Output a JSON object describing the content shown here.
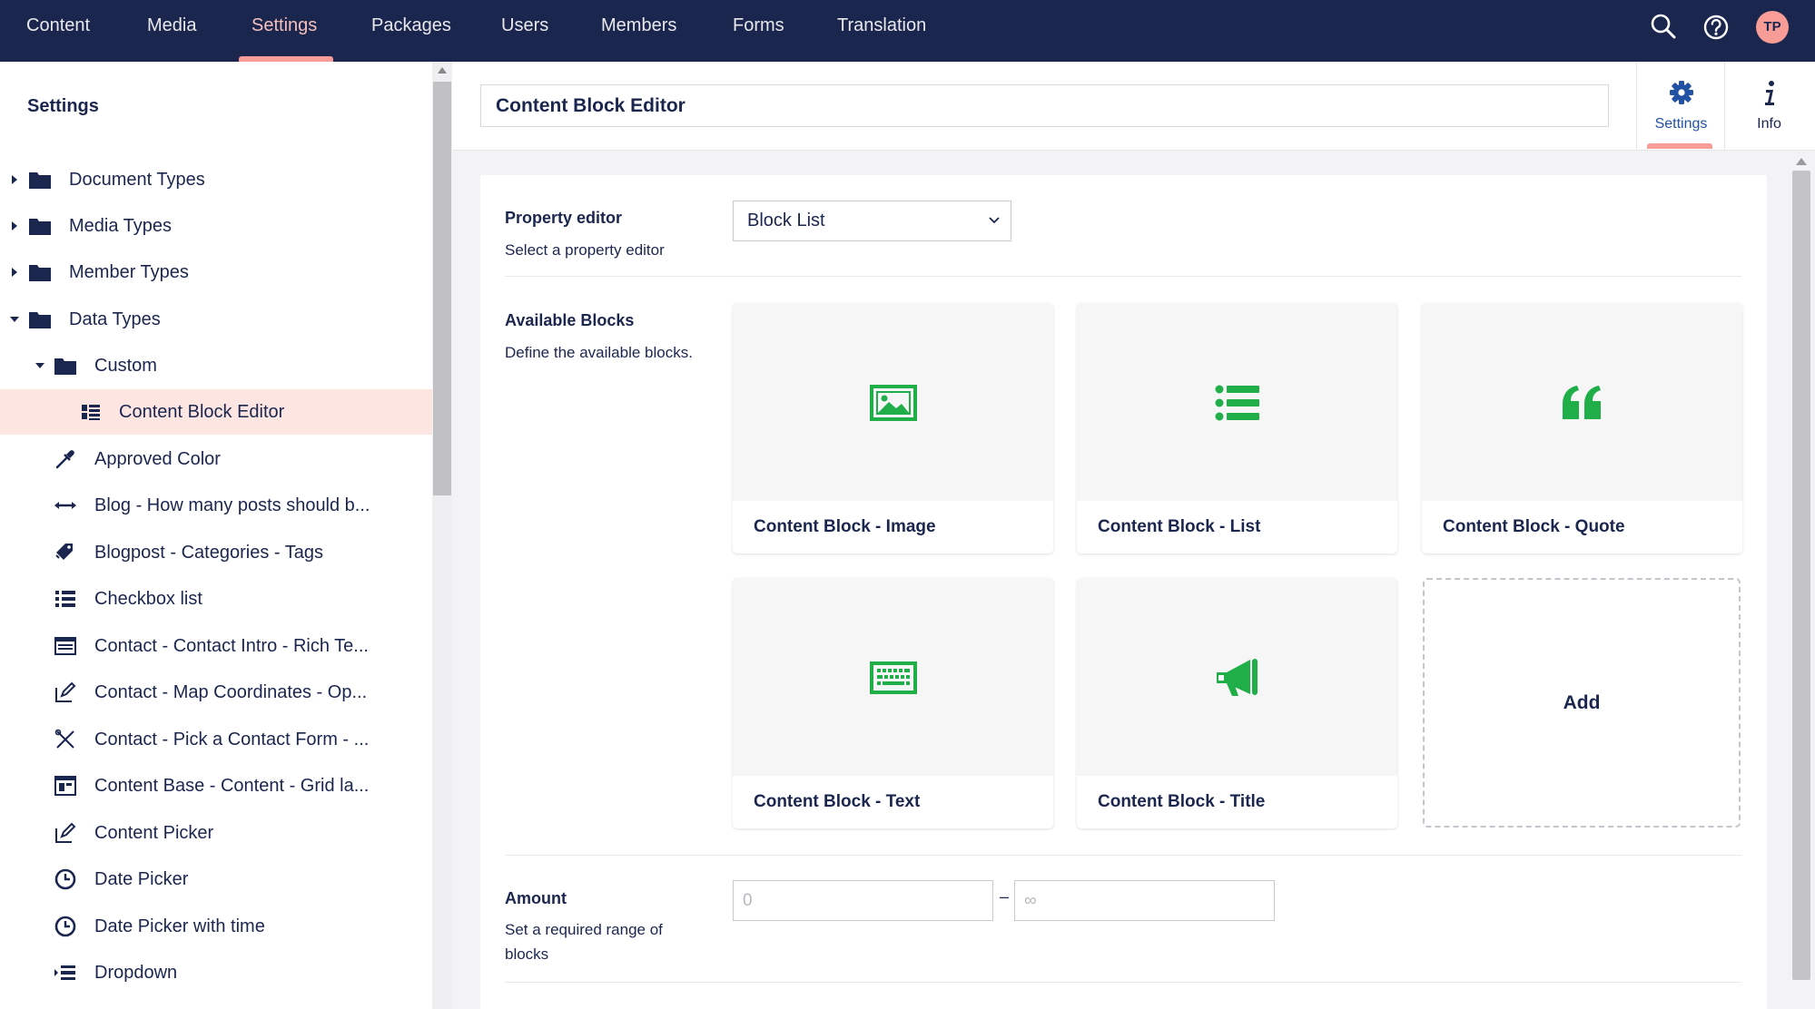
{
  "colors": {
    "nav_bg": "#1b264f",
    "accent": "#f79c96",
    "block_icon": "#1fae48",
    "selected_bg": "#fde5e1"
  },
  "nav": {
    "items": [
      {
        "label": "Content"
      },
      {
        "label": "Media"
      },
      {
        "label": "Settings",
        "active": true
      },
      {
        "label": "Packages"
      },
      {
        "label": "Users"
      },
      {
        "label": "Members"
      },
      {
        "label": "Forms"
      },
      {
        "label": "Translation"
      }
    ],
    "search_icon": "search-icon",
    "help_icon": "help-icon",
    "avatar_initials": "TP"
  },
  "sidebar": {
    "title": "Settings",
    "tree": [
      {
        "label": "Document Types",
        "icon": "folder-icon",
        "caret": "collapsed"
      },
      {
        "label": "Media Types",
        "icon": "folder-icon",
        "caret": "collapsed"
      },
      {
        "label": "Member Types",
        "icon": "folder-icon",
        "caret": "collapsed"
      },
      {
        "label": "Data Types",
        "icon": "folder-icon",
        "caret": "expanded"
      },
      {
        "label": "Custom",
        "icon": "folder-icon",
        "caret": "expanded"
      },
      {
        "label": "Content Block Editor",
        "icon": "block-list-icon",
        "selected": true
      },
      {
        "label": "Approved Color",
        "icon": "eyedropper-icon"
      },
      {
        "label": "Blog - How many posts should b...",
        "icon": "range-arrows-icon"
      },
      {
        "label": "Blogpost - Categories - Tags",
        "icon": "tags-icon"
      },
      {
        "label": "Checkbox list",
        "icon": "checklist-icon"
      },
      {
        "label": "Contact - Contact Intro - Rich Te...",
        "icon": "rich-text-icon"
      },
      {
        "label": "Contact - Map Coordinates - Op...",
        "icon": "edit-icon"
      },
      {
        "label": "Contact - Pick a Contact Form - ...",
        "icon": "crossed-tools-icon"
      },
      {
        "label": "Content Base - Content - Grid la...",
        "icon": "grid-layout-icon"
      },
      {
        "label": "Content Picker",
        "icon": "edit-icon"
      },
      {
        "label": "Date Picker",
        "icon": "clock-icon"
      },
      {
        "label": "Date Picker with time",
        "icon": "clock-icon"
      },
      {
        "label": "Dropdown",
        "icon": "dropdown-list-icon"
      }
    ]
  },
  "editor": {
    "name_value": "Content Block Editor",
    "apps": [
      {
        "label": "Settings",
        "icon": "gear-icon",
        "active": true
      },
      {
        "label": "Info",
        "icon": "info-icon"
      }
    ]
  },
  "properties": {
    "property_editor": {
      "label": "Property editor",
      "description": "Select a property editor",
      "selected": "Block List"
    },
    "available_blocks": {
      "label": "Available Blocks",
      "description": "Define the available blocks.",
      "blocks": [
        {
          "name": "Content Block - Image",
          "icon": "picture-icon"
        },
        {
          "name": "Content Block - List",
          "icon": "list-icon"
        },
        {
          "name": "Content Block - Quote",
          "icon": "quote-icon"
        },
        {
          "name": "Content Block - Text",
          "icon": "keyboard-icon"
        },
        {
          "name": "Content Block - Title",
          "icon": "megaphone-icon"
        }
      ],
      "add_label": "Add"
    },
    "amount": {
      "label": "Amount",
      "description_line1": "Set a required range of",
      "description_line2": "blocks",
      "min_placeholder": "0",
      "separator": "–",
      "max_placeholder": "∞"
    }
  }
}
